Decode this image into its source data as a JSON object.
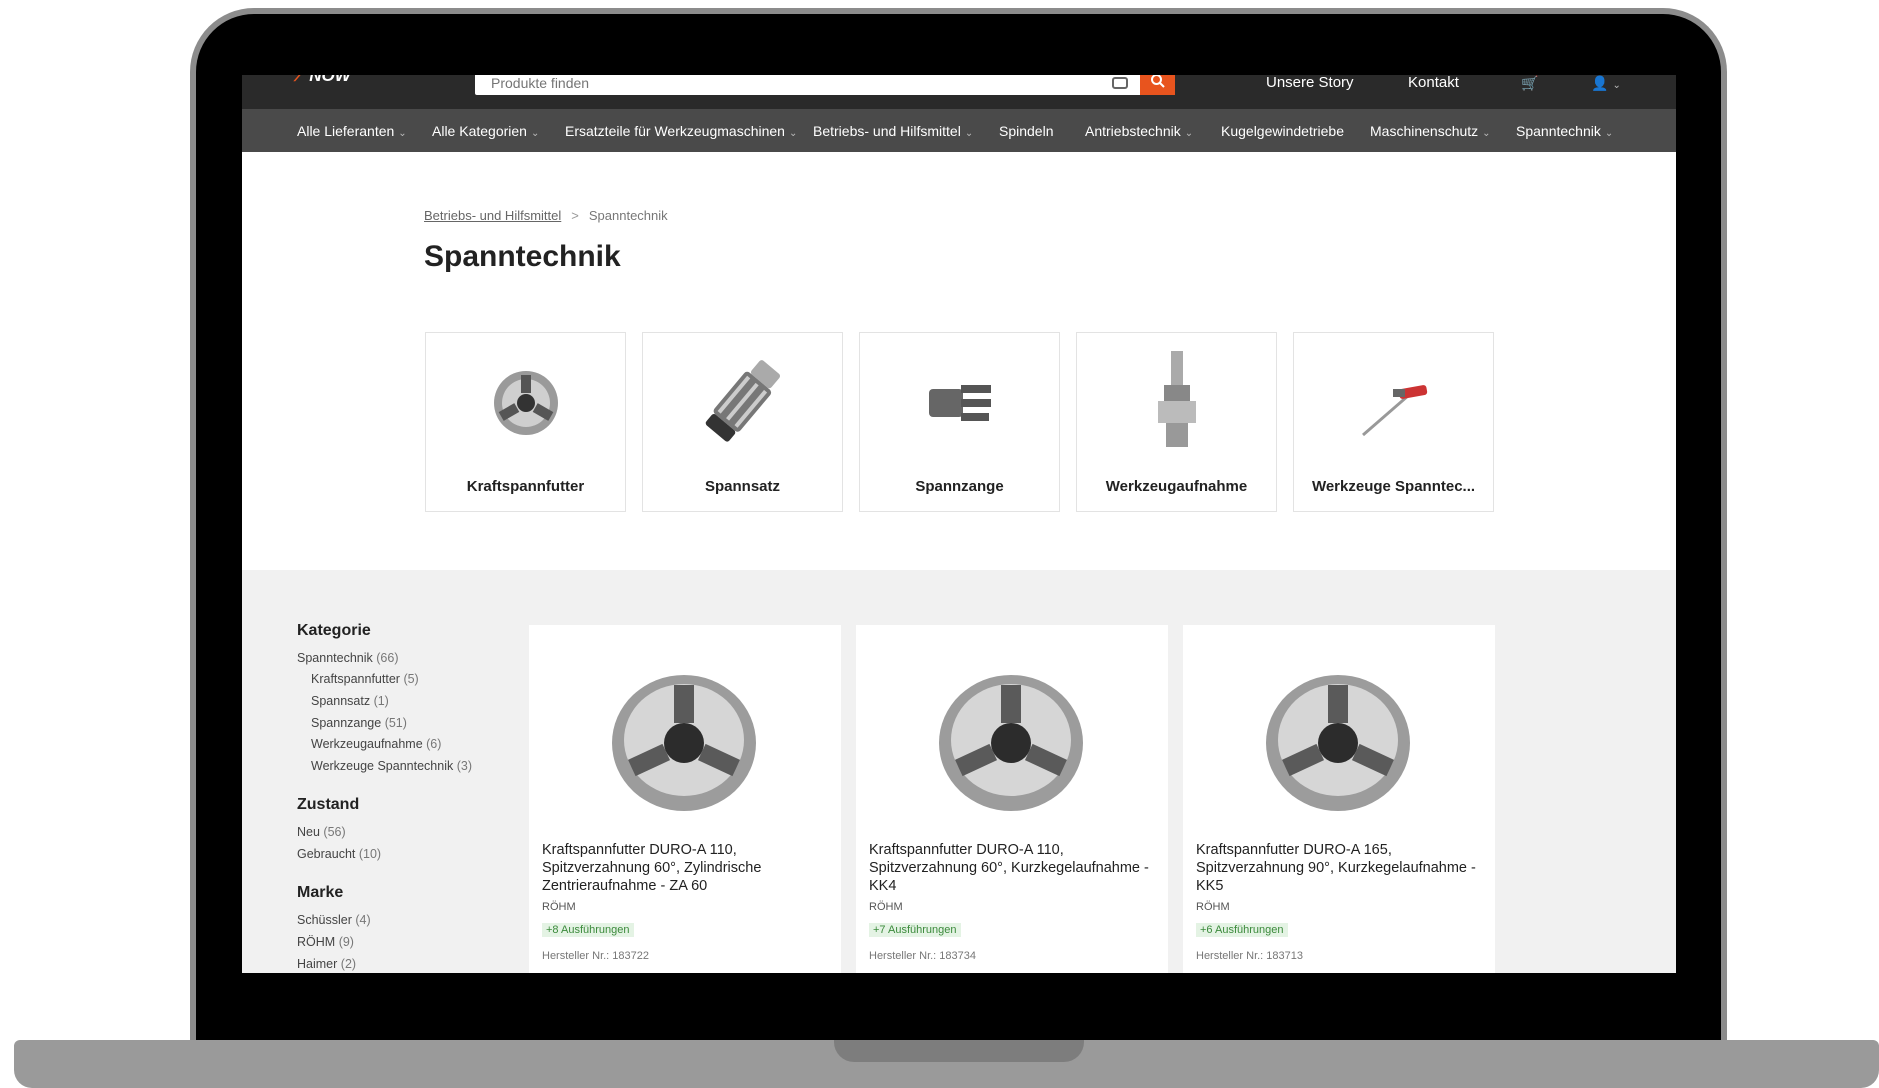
{
  "header": {
    "logo_text": "NOW",
    "search_placeholder": "Produkte finden",
    "links": [
      "Unsere Story",
      "Kontakt"
    ]
  },
  "nav": [
    {
      "label": "Alle Lieferanten",
      "dropdown": true
    },
    {
      "label": "Alle Kategorien",
      "dropdown": true
    },
    {
      "label": "Ersatzteile für Werkzeugmaschinen",
      "dropdown": true
    },
    {
      "label": "Betriebs- und Hilfsmittel",
      "dropdown": true
    },
    {
      "label": "Spindeln",
      "dropdown": false
    },
    {
      "label": "Antriebstechnik",
      "dropdown": true
    },
    {
      "label": "Kugelgewindetriebe",
      "dropdown": false
    },
    {
      "label": "Maschinenschutz",
      "dropdown": true
    },
    {
      "label": "Spanntechnik",
      "dropdown": true
    }
  ],
  "breadcrumb": {
    "parent": "Betriebs- und Hilfsmittel",
    "separator": ">",
    "current": "Spanntechnik"
  },
  "page_title": "Spanntechnik",
  "categories": [
    {
      "label": "Kraftspannfutter",
      "icon": "chuck-image"
    },
    {
      "label": "Spannsatz",
      "icon": "clamping-set-image"
    },
    {
      "label": "Spannzange",
      "icon": "collet-image"
    },
    {
      "label": "Werkzeugaufnahme",
      "icon": "tool-holder-image"
    },
    {
      "label": "Werkzeuge Spanntec...",
      "icon": "tool-image"
    }
  ],
  "filters": {
    "kategorie_title": "Kategorie",
    "kategorie": [
      {
        "label": "Spanntechnik",
        "count": "(66)",
        "indent": false
      },
      {
        "label": "Kraftspannfutter",
        "count": "(5)",
        "indent": true
      },
      {
        "label": "Spannsatz",
        "count": "(1)",
        "indent": true
      },
      {
        "label": "Spannzange",
        "count": "(51)",
        "indent": true
      },
      {
        "label": "Werkzeugaufnahme",
        "count": "(6)",
        "indent": true
      },
      {
        "label": "Werkzeuge Spanntechnik",
        "count": "(3)",
        "indent": true
      }
    ],
    "zustand_title": "Zustand",
    "zustand": [
      {
        "label": "Neu",
        "count": "(56)"
      },
      {
        "label": "Gebraucht",
        "count": "(10)"
      }
    ],
    "marke_title": "Marke",
    "marke": [
      {
        "label": "Schüssler",
        "count": "(4)"
      },
      {
        "label": "RÖHM",
        "count": "(9)"
      },
      {
        "label": "Haimer",
        "count": "(2)"
      }
    ]
  },
  "products": [
    {
      "name": "Kraftspannfutter DURO-A 110, Spitzverzahnung 60°, Zylindrische Zentrieraufnahme - ZA 60",
      "brand": "RÖHM",
      "variants": "+8 Ausführungen",
      "hersteller_nr": "Hersteller Nr.: 183722"
    },
    {
      "name": "Kraftspannfutter DURO-A 110, Spitzverzahnung 60°, Kurzkegelaufnahme - KK4",
      "brand": "RÖHM",
      "variants": "+7 Ausführungen",
      "hersteller_nr": "Hersteller Nr.: 183734"
    },
    {
      "name": "Kraftspannfutter DURO-A 165, Spitzverzahnung 90°, Kurzkegelaufnahme - KK5",
      "brand": "RÖHM",
      "variants": "+6 Ausführungen",
      "hersteller_nr": "Hersteller Nr.: 183713"
    }
  ],
  "colors": {
    "accent": "#e8541e",
    "topbar": "#2a2a2a",
    "navbar": "#4a4a4a",
    "variant_badge": "#3b8a3b"
  }
}
